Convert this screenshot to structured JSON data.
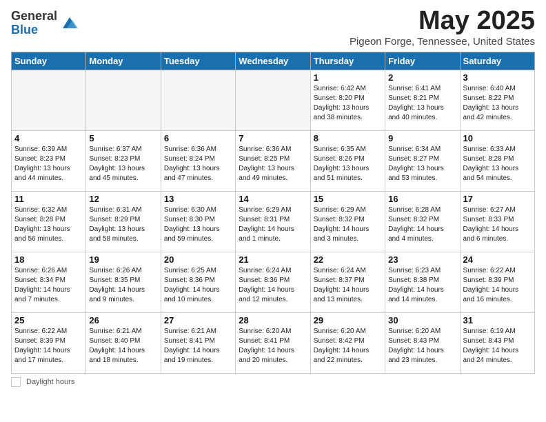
{
  "header": {
    "logo_general": "General",
    "logo_blue": "Blue",
    "month_year": "May 2025",
    "location": "Pigeon Forge, Tennessee, United States"
  },
  "days_of_week": [
    "Sunday",
    "Monday",
    "Tuesday",
    "Wednesday",
    "Thursday",
    "Friday",
    "Saturday"
  ],
  "weeks": [
    [
      {
        "day": "",
        "info": ""
      },
      {
        "day": "",
        "info": ""
      },
      {
        "day": "",
        "info": ""
      },
      {
        "day": "",
        "info": ""
      },
      {
        "day": "1",
        "info": "Sunrise: 6:42 AM\nSunset: 8:20 PM\nDaylight: 13 hours\nand 38 minutes."
      },
      {
        "day": "2",
        "info": "Sunrise: 6:41 AM\nSunset: 8:21 PM\nDaylight: 13 hours\nand 40 minutes."
      },
      {
        "day": "3",
        "info": "Sunrise: 6:40 AM\nSunset: 8:22 PM\nDaylight: 13 hours\nand 42 minutes."
      }
    ],
    [
      {
        "day": "4",
        "info": "Sunrise: 6:39 AM\nSunset: 8:23 PM\nDaylight: 13 hours\nand 44 minutes."
      },
      {
        "day": "5",
        "info": "Sunrise: 6:37 AM\nSunset: 8:23 PM\nDaylight: 13 hours\nand 45 minutes."
      },
      {
        "day": "6",
        "info": "Sunrise: 6:36 AM\nSunset: 8:24 PM\nDaylight: 13 hours\nand 47 minutes."
      },
      {
        "day": "7",
        "info": "Sunrise: 6:36 AM\nSunset: 8:25 PM\nDaylight: 13 hours\nand 49 minutes."
      },
      {
        "day": "8",
        "info": "Sunrise: 6:35 AM\nSunset: 8:26 PM\nDaylight: 13 hours\nand 51 minutes."
      },
      {
        "day": "9",
        "info": "Sunrise: 6:34 AM\nSunset: 8:27 PM\nDaylight: 13 hours\nand 53 minutes."
      },
      {
        "day": "10",
        "info": "Sunrise: 6:33 AM\nSunset: 8:28 PM\nDaylight: 13 hours\nand 54 minutes."
      }
    ],
    [
      {
        "day": "11",
        "info": "Sunrise: 6:32 AM\nSunset: 8:28 PM\nDaylight: 13 hours\nand 56 minutes."
      },
      {
        "day": "12",
        "info": "Sunrise: 6:31 AM\nSunset: 8:29 PM\nDaylight: 13 hours\nand 58 minutes."
      },
      {
        "day": "13",
        "info": "Sunrise: 6:30 AM\nSunset: 8:30 PM\nDaylight: 13 hours\nand 59 minutes."
      },
      {
        "day": "14",
        "info": "Sunrise: 6:29 AM\nSunset: 8:31 PM\nDaylight: 14 hours\nand 1 minute."
      },
      {
        "day": "15",
        "info": "Sunrise: 6:29 AM\nSunset: 8:32 PM\nDaylight: 14 hours\nand 3 minutes."
      },
      {
        "day": "16",
        "info": "Sunrise: 6:28 AM\nSunset: 8:32 PM\nDaylight: 14 hours\nand 4 minutes."
      },
      {
        "day": "17",
        "info": "Sunrise: 6:27 AM\nSunset: 8:33 PM\nDaylight: 14 hours\nand 6 minutes."
      }
    ],
    [
      {
        "day": "18",
        "info": "Sunrise: 6:26 AM\nSunset: 8:34 PM\nDaylight: 14 hours\nand 7 minutes."
      },
      {
        "day": "19",
        "info": "Sunrise: 6:26 AM\nSunset: 8:35 PM\nDaylight: 14 hours\nand 9 minutes."
      },
      {
        "day": "20",
        "info": "Sunrise: 6:25 AM\nSunset: 8:36 PM\nDaylight: 14 hours\nand 10 minutes."
      },
      {
        "day": "21",
        "info": "Sunrise: 6:24 AM\nSunset: 8:36 PM\nDaylight: 14 hours\nand 12 minutes."
      },
      {
        "day": "22",
        "info": "Sunrise: 6:24 AM\nSunset: 8:37 PM\nDaylight: 14 hours\nand 13 minutes."
      },
      {
        "day": "23",
        "info": "Sunrise: 6:23 AM\nSunset: 8:38 PM\nDaylight: 14 hours\nand 14 minutes."
      },
      {
        "day": "24",
        "info": "Sunrise: 6:22 AM\nSunset: 8:39 PM\nDaylight: 14 hours\nand 16 minutes."
      }
    ],
    [
      {
        "day": "25",
        "info": "Sunrise: 6:22 AM\nSunset: 8:39 PM\nDaylight: 14 hours\nand 17 minutes."
      },
      {
        "day": "26",
        "info": "Sunrise: 6:21 AM\nSunset: 8:40 PM\nDaylight: 14 hours\nand 18 minutes."
      },
      {
        "day": "27",
        "info": "Sunrise: 6:21 AM\nSunset: 8:41 PM\nDaylight: 14 hours\nand 19 minutes."
      },
      {
        "day": "28",
        "info": "Sunrise: 6:20 AM\nSunset: 8:41 PM\nDaylight: 14 hours\nand 20 minutes."
      },
      {
        "day": "29",
        "info": "Sunrise: 6:20 AM\nSunset: 8:42 PM\nDaylight: 14 hours\nand 22 minutes."
      },
      {
        "day": "30",
        "info": "Sunrise: 6:20 AM\nSunset: 8:43 PM\nDaylight: 14 hours\nand 23 minutes."
      },
      {
        "day": "31",
        "info": "Sunrise: 6:19 AM\nSunset: 8:43 PM\nDaylight: 14 hours\nand 24 minutes."
      }
    ]
  ],
  "footer": {
    "daylight_label": "Daylight hours"
  }
}
